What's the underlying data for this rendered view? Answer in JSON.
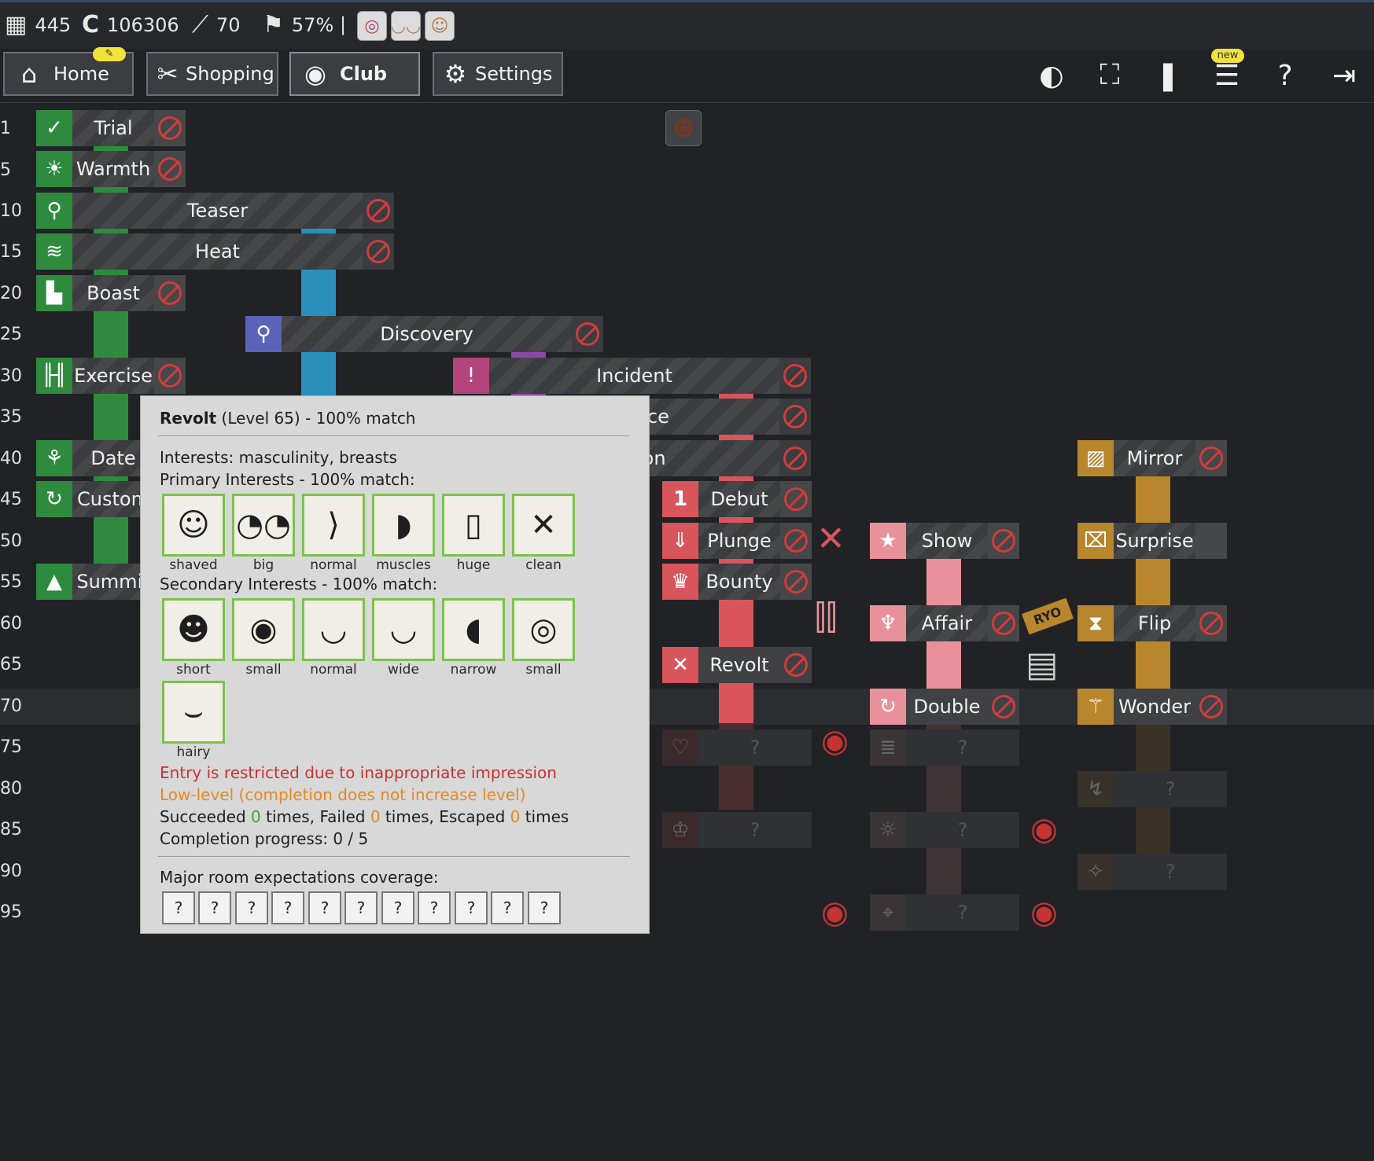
{
  "topbar": {
    "days": "445",
    "money": "106306",
    "level": "70",
    "progress": "57%",
    "separator": "|"
  },
  "nav": {
    "home": "Home",
    "shopping": "Shopping",
    "club": "Club",
    "settings": "Settings",
    "chat_badge": "new"
  },
  "row_numbers": [
    "1",
    "5",
    "10",
    "15",
    "20",
    "25",
    "30",
    "35",
    "40",
    "45",
    "50",
    "55",
    "60",
    "65",
    "70",
    "75",
    "80",
    "85",
    "90",
    "95"
  ],
  "rooms": {
    "trial": "Trial",
    "warmth": "Warmth",
    "teaser": "Teaser",
    "heat": "Heat",
    "boast": "Boast",
    "discovery": "Discovery",
    "exercise": "Exercise",
    "incident": "Incident",
    "service": "Service",
    "date": "Date",
    "option": "Option",
    "custom": "Custom",
    "summit": "Summit",
    "mirror": "Mirror",
    "debut": "Debut",
    "plunge": "Plunge",
    "show": "Show",
    "surprise": "Surprise",
    "bounty": "Bounty",
    "affair": "Affair",
    "flip": "Flip",
    "revolt": "Revolt",
    "double": "Double",
    "wonder": "Wonder",
    "unknown": "?"
  },
  "popup": {
    "name": "Revolt",
    "level_match": " (Level 65) - 100% match",
    "interests": "Interests: masculinity, breasts",
    "primary_header": "Primary Interests - 100% match:",
    "primary": [
      "shaved",
      "big",
      "normal",
      "muscles",
      "huge",
      "clean"
    ],
    "secondary_header": "Secondary Interests - 100% match:",
    "secondary": [
      "short",
      "small",
      "normal",
      "wide",
      "narrow",
      "small",
      "hairy"
    ],
    "restricted": "Entry is restricted due to inappropriate impression",
    "low_level": "Low-level (completion does not increase level)",
    "succeeded_pre": "Succeeded ",
    "succeeded_n": "0",
    "failed_pre": " times, Failed ",
    "failed_n": "0",
    "escaped_pre": " times, Escaped ",
    "escaped_n": "0",
    "times": " times",
    "completion": "Completion progress: 0 / 5",
    "coverage_header": "Major room expectations coverage:",
    "coverage": [
      "?",
      "?",
      "?",
      "?",
      "?",
      "?",
      "?",
      "?",
      "?",
      "?",
      "?"
    ]
  },
  "decor": {
    "ryo": "RYO"
  },
  "colors": {
    "green": "#2e8b3e",
    "blue": "#2a8fbd",
    "purple": "#8a4aa8",
    "red": "#d9555c",
    "pink": "#e8919a",
    "gold": "#b8862c"
  }
}
